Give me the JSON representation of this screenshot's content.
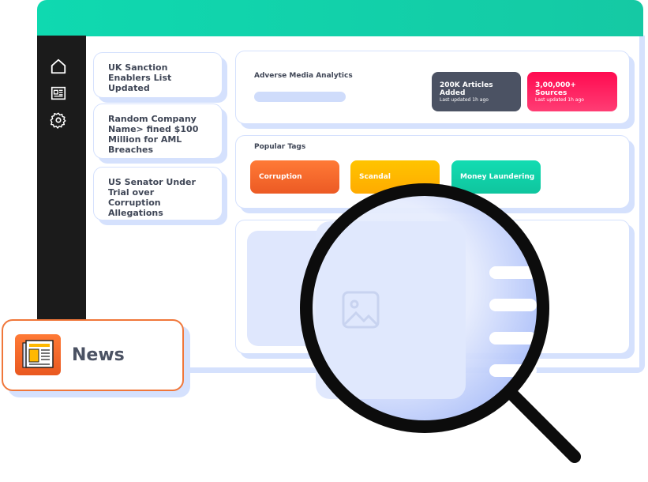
{
  "news_items": [
    {
      "title": "UK Sanction Enablers List Updated"
    },
    {
      "title": "Random Company Name> fined $100 Million for AML Breaches"
    },
    {
      "title": "US Senator Under Trial over Corruption Allegations"
    }
  ],
  "analytics": {
    "title": "Adverse Media Analytics",
    "stats": [
      {
        "value": "200K Articles Added",
        "sub": "Last updated 1h ago",
        "color": "#4b5263"
      },
      {
        "value": "3,00,000+ Sources",
        "sub": "Last updated 1h ago",
        "color": "#ff1456"
      }
    ]
  },
  "tags": {
    "title": "Popular Tags",
    "items": [
      {
        "label": "Corruption",
        "color": "#f26a2e"
      },
      {
        "label": "Scandal",
        "color": "#ffb800"
      },
      {
        "label": "Money Laundering",
        "color": "#10d2a8"
      }
    ]
  },
  "sidebar": {
    "icons": [
      "home-icon",
      "newspaper-icon",
      "gear-icon"
    ]
  },
  "badge": {
    "label": "News",
    "icon": "newspaper-icon"
  },
  "colors": {
    "accent": "#10d2a8",
    "border": "#f0773a",
    "shadow": "#d5e1fd"
  }
}
